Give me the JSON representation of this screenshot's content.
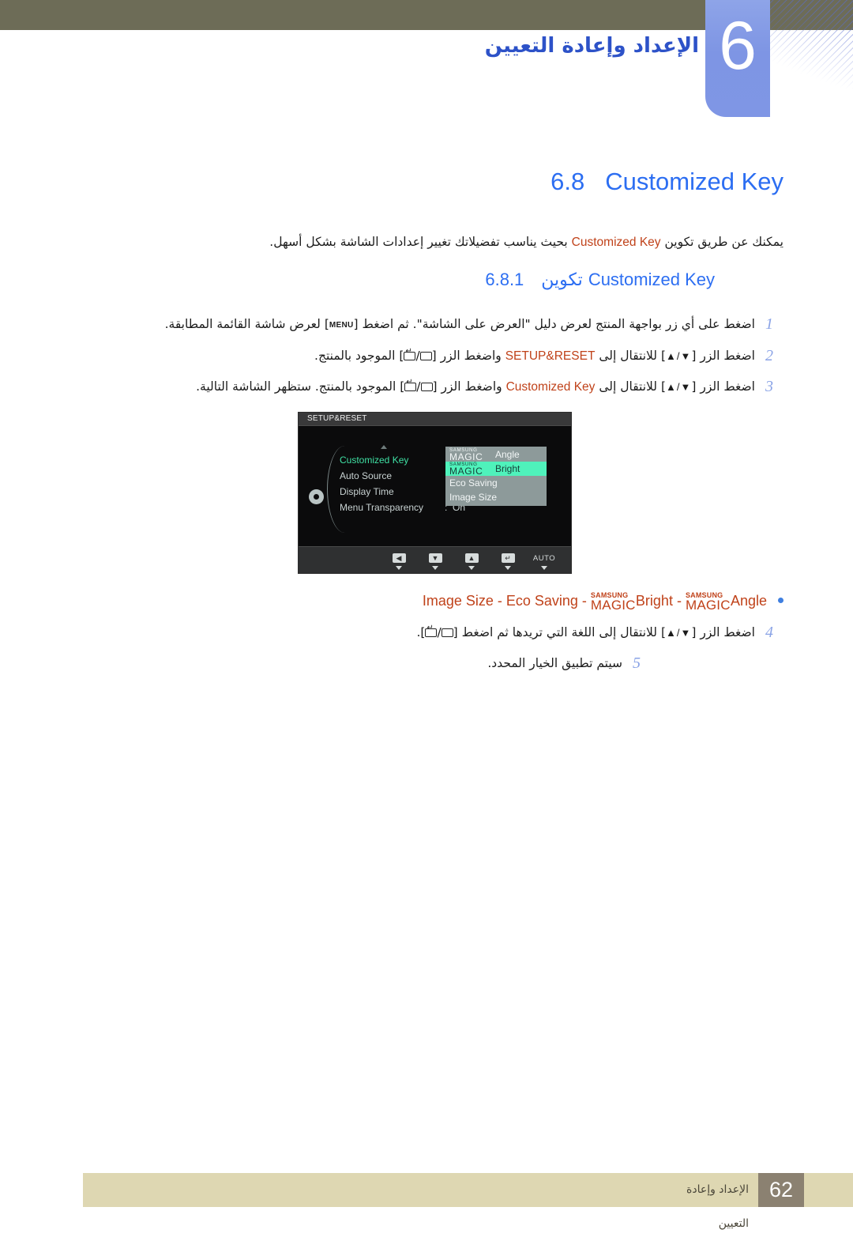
{
  "header": {
    "chapter_number": "6",
    "chapter_title": "الإعداد وإعادة التعيين"
  },
  "section": {
    "number": "6.8",
    "label": "Customized Key",
    "intro_before": "يمكنك عن طريق تكوين ",
    "intro_term": "Customized Key",
    "intro_after": " بحيث يناسب تفضيلاتك تغيير إعدادات الشاشة بشكل أسهل."
  },
  "subsection": {
    "number": "6.8.1",
    "label_arabic": "تكوين",
    "label_latin": "Customized Key"
  },
  "steps": [
    {
      "num": "1",
      "part1": "اضغط على أي زر بواجهة المنتج لعرض دليل \"العرض على الشاشة\". ثم اضغط [",
      "key": "MENU",
      "part2": "] لعرض شاشة القائمة المطابقة."
    },
    {
      "num": "2",
      "part1": "اضغط الزر [",
      "arrows": "▲/▼",
      "part2": "] للانتقال إلى ",
      "term": "SETUP&RESET",
      "part3": " واضغط الزر [",
      "part4": "] الموجود بالمنتج."
    },
    {
      "num": "3",
      "part1": "اضغط الزر [",
      "arrows": "▲/▼",
      "part2": "] للانتقال إلى ",
      "term": "Customized Key",
      "part3": " واضغط الزر [",
      "part4": "] الموجود بالمنتج. ستظهر الشاشة التالية."
    }
  ],
  "steps_tail": [
    {
      "num": "4",
      "part1": "اضغط الزر [",
      "arrows": "▲/▼",
      "part2": "] للانتقال إلى اللغة التي تريدها ثم اضغط [",
      "part3": "]."
    },
    {
      "num": "5",
      "text": "سيتم تطبيق الخيار المحدد."
    }
  ],
  "bullet": {
    "items_text": "Image Size - Eco Saving - ",
    "magic_small": "SAMSUNG",
    "magic_large": "MAGIC",
    "bright": "Bright",
    "sep": " - ",
    "angle": "Angle"
  },
  "osd": {
    "title": "SETUP&RESET",
    "menu_items": [
      {
        "label": "Customized Key",
        "colon": ":",
        "value": ""
      },
      {
        "label": "Auto Source",
        "colon": ":",
        "value": ""
      },
      {
        "label": "Display Time",
        "colon": ":",
        "value": ""
      },
      {
        "label": "Menu Transparency",
        "colon": ":",
        "value": "On"
      }
    ],
    "dropdown": [
      {
        "samsung": "SAMSUNG",
        "magic": "MAGIC",
        "suffix": " Angle",
        "selected": false
      },
      {
        "samsung": "SAMSUNG",
        "magic": "MAGIC",
        "suffix": " Bright",
        "selected": true
      },
      {
        "samsung": "",
        "magic": "",
        "suffix": "Eco Saving",
        "selected": false
      },
      {
        "samsung": "",
        "magic": "",
        "suffix": "Image Size",
        "selected": false
      }
    ],
    "footer_keys": [
      {
        "cap": "◀",
        "plain": false
      },
      {
        "cap": "▼",
        "plain": false
      },
      {
        "cap": "▲",
        "plain": false
      },
      {
        "cap": "↵",
        "plain": false
      },
      {
        "cap": "AUTO",
        "plain": true
      },
      {
        "cap": "⏻",
        "plain": true
      }
    ]
  },
  "footer": {
    "page_number": "62",
    "text": "الإعداد وإعادة التعيين"
  },
  "colors": {
    "top_bar": "#6d6c57",
    "chapter_blue": "#7e95e4",
    "heading_blue": "#2c6ef2",
    "title_blue": "#2d52c8",
    "term_orange": "#c0421a",
    "step_num_blue": "#8aa3e6",
    "footer_band": "#ded7b2",
    "footer_box": "#8b8171",
    "osd_highlight_green": "#4ff2bb",
    "osd_active_green": "#3fe0a4"
  }
}
